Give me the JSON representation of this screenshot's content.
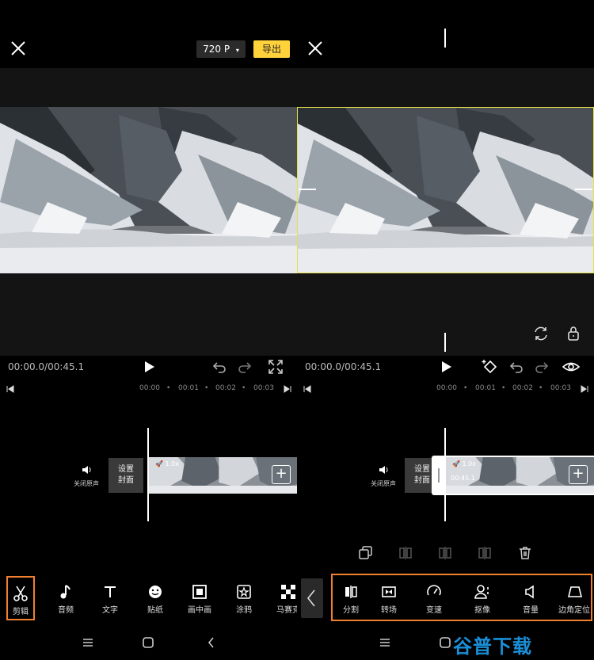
{
  "left": {
    "resolution_label": "720 P",
    "resolution_caret": "▾",
    "export_label": "导出",
    "timecode": "00:00.0/00:45.1",
    "ruler_labels": [
      "00:00",
      "00:01",
      "00:02",
      "00:03"
    ],
    "mute_label": "关闭原声",
    "cover_label": "设置\n封面",
    "speed_label": "1.0x",
    "toolbar": [
      {
        "label": "剪辑",
        "icon": "scissors-icon"
      },
      {
        "label": "音频",
        "icon": "music-note-icon"
      },
      {
        "label": "文字",
        "icon": "text-icon"
      },
      {
        "label": "贴纸",
        "icon": "smiley-icon"
      },
      {
        "label": "画中画",
        "icon": "picture-in-picture-icon"
      },
      {
        "label": "涂鸦",
        "icon": "doodle-icon"
      },
      {
        "label": "马赛克",
        "icon": "mosaic-icon"
      }
    ]
  },
  "right": {
    "timecode": "00:00.0/00:45.1",
    "ruler_labels": [
      "00:00",
      "00:01",
      "00:02",
      "00:03"
    ],
    "mute_label": "关闭原声",
    "cover_label": "设置\n封面",
    "speed_label": "1.0x",
    "clip_duration": "00:45.1",
    "toolbar": [
      {
        "label": "分割",
        "icon": "split-icon"
      },
      {
        "label": "转场",
        "icon": "transition-icon"
      },
      {
        "label": "变速",
        "icon": "speed-icon"
      },
      {
        "label": "抠像",
        "icon": "cutout-icon"
      },
      {
        "label": "音量",
        "icon": "volume-icon"
      },
      {
        "label": "边角定位",
        "icon": "corner-pin-icon"
      }
    ]
  },
  "watermark": "谷普下载",
  "colors": {
    "accent": "#ffd23c",
    "highlight": "#f08030",
    "selection": "#e8e04a"
  }
}
